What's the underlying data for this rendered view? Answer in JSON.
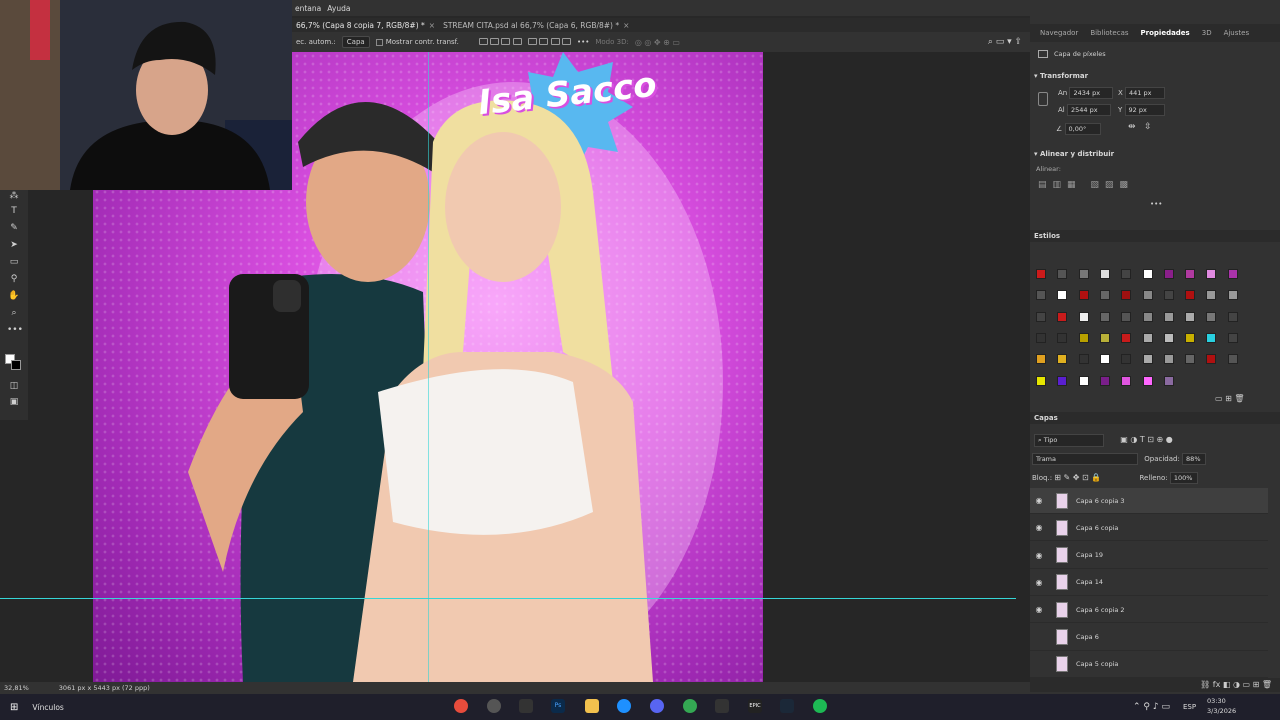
{
  "menu": {
    "items": [
      "entana",
      "Ayuda"
    ]
  },
  "document_tabs": [
    {
      "label": "66,7% (Capa 8 copia 7, RGB/8#) *",
      "active": true
    },
    {
      "label": "STREAM CITA.psd al 66,7% (Capa 6, RGB/8#) *",
      "active": false
    }
  ],
  "options_bar": {
    "auto_select": "ec. autom.:",
    "target": "Capa",
    "show_transform": "Mostrar contr. transf.",
    "mode_3d": "Modo 3D:"
  },
  "poster": {
    "title": "Isa Sacco",
    "colors": {
      "bg_inner": "#f58ef7",
      "bg_outer": "#7f1a96",
      "badge": "#58b8f0"
    }
  },
  "statusbar": {
    "zoom": "32,81%",
    "doc_size": "3061 px x 5443 px (72 ppp)"
  },
  "right_tabs": [
    "Navegador",
    "Bibliotecas",
    "Propiedades",
    "3D",
    "Ajustes"
  ],
  "properties": {
    "layer_type": "Capa de píxeles",
    "transform": {
      "title": "Transformar",
      "an_label": "An",
      "an": "2434 px",
      "al_label": "Al",
      "al": "2544 px",
      "x_label": "X",
      "x": "441 px",
      "y_label": "Y",
      "y": "92 px",
      "angle": "0,00°"
    },
    "align": {
      "title": "Alinear y distribuir",
      "label": "Alinear:"
    }
  },
  "styles": {
    "title": "Estilos"
  },
  "layers": {
    "title": "Capas",
    "filter": "Tipo",
    "blend_mode": "Trama",
    "opacity_label": "Opacidad:",
    "opacity": "88%",
    "lock_label": "Bloq.:",
    "fill_label": "Relleno:",
    "fill": "100%",
    "items": [
      {
        "name": "Capa 6 copia 3",
        "visible": true,
        "selected": true
      },
      {
        "name": "Capa 6 copia",
        "visible": true,
        "selected": false
      },
      {
        "name": "Capa 19",
        "visible": true,
        "selected": false
      },
      {
        "name": "Capa 14",
        "visible": true,
        "selected": false
      },
      {
        "name": "Capa 6 copia 2",
        "visible": true,
        "selected": false
      },
      {
        "name": "Capa 6",
        "visible": false,
        "selected": false
      },
      {
        "name": "Capa 5 copia",
        "visible": false,
        "selected": false
      }
    ]
  },
  "taskbar": {
    "search_label": "Vínculos",
    "lang": "ESP",
    "time": "03:30",
    "date": "3/3/2026"
  }
}
